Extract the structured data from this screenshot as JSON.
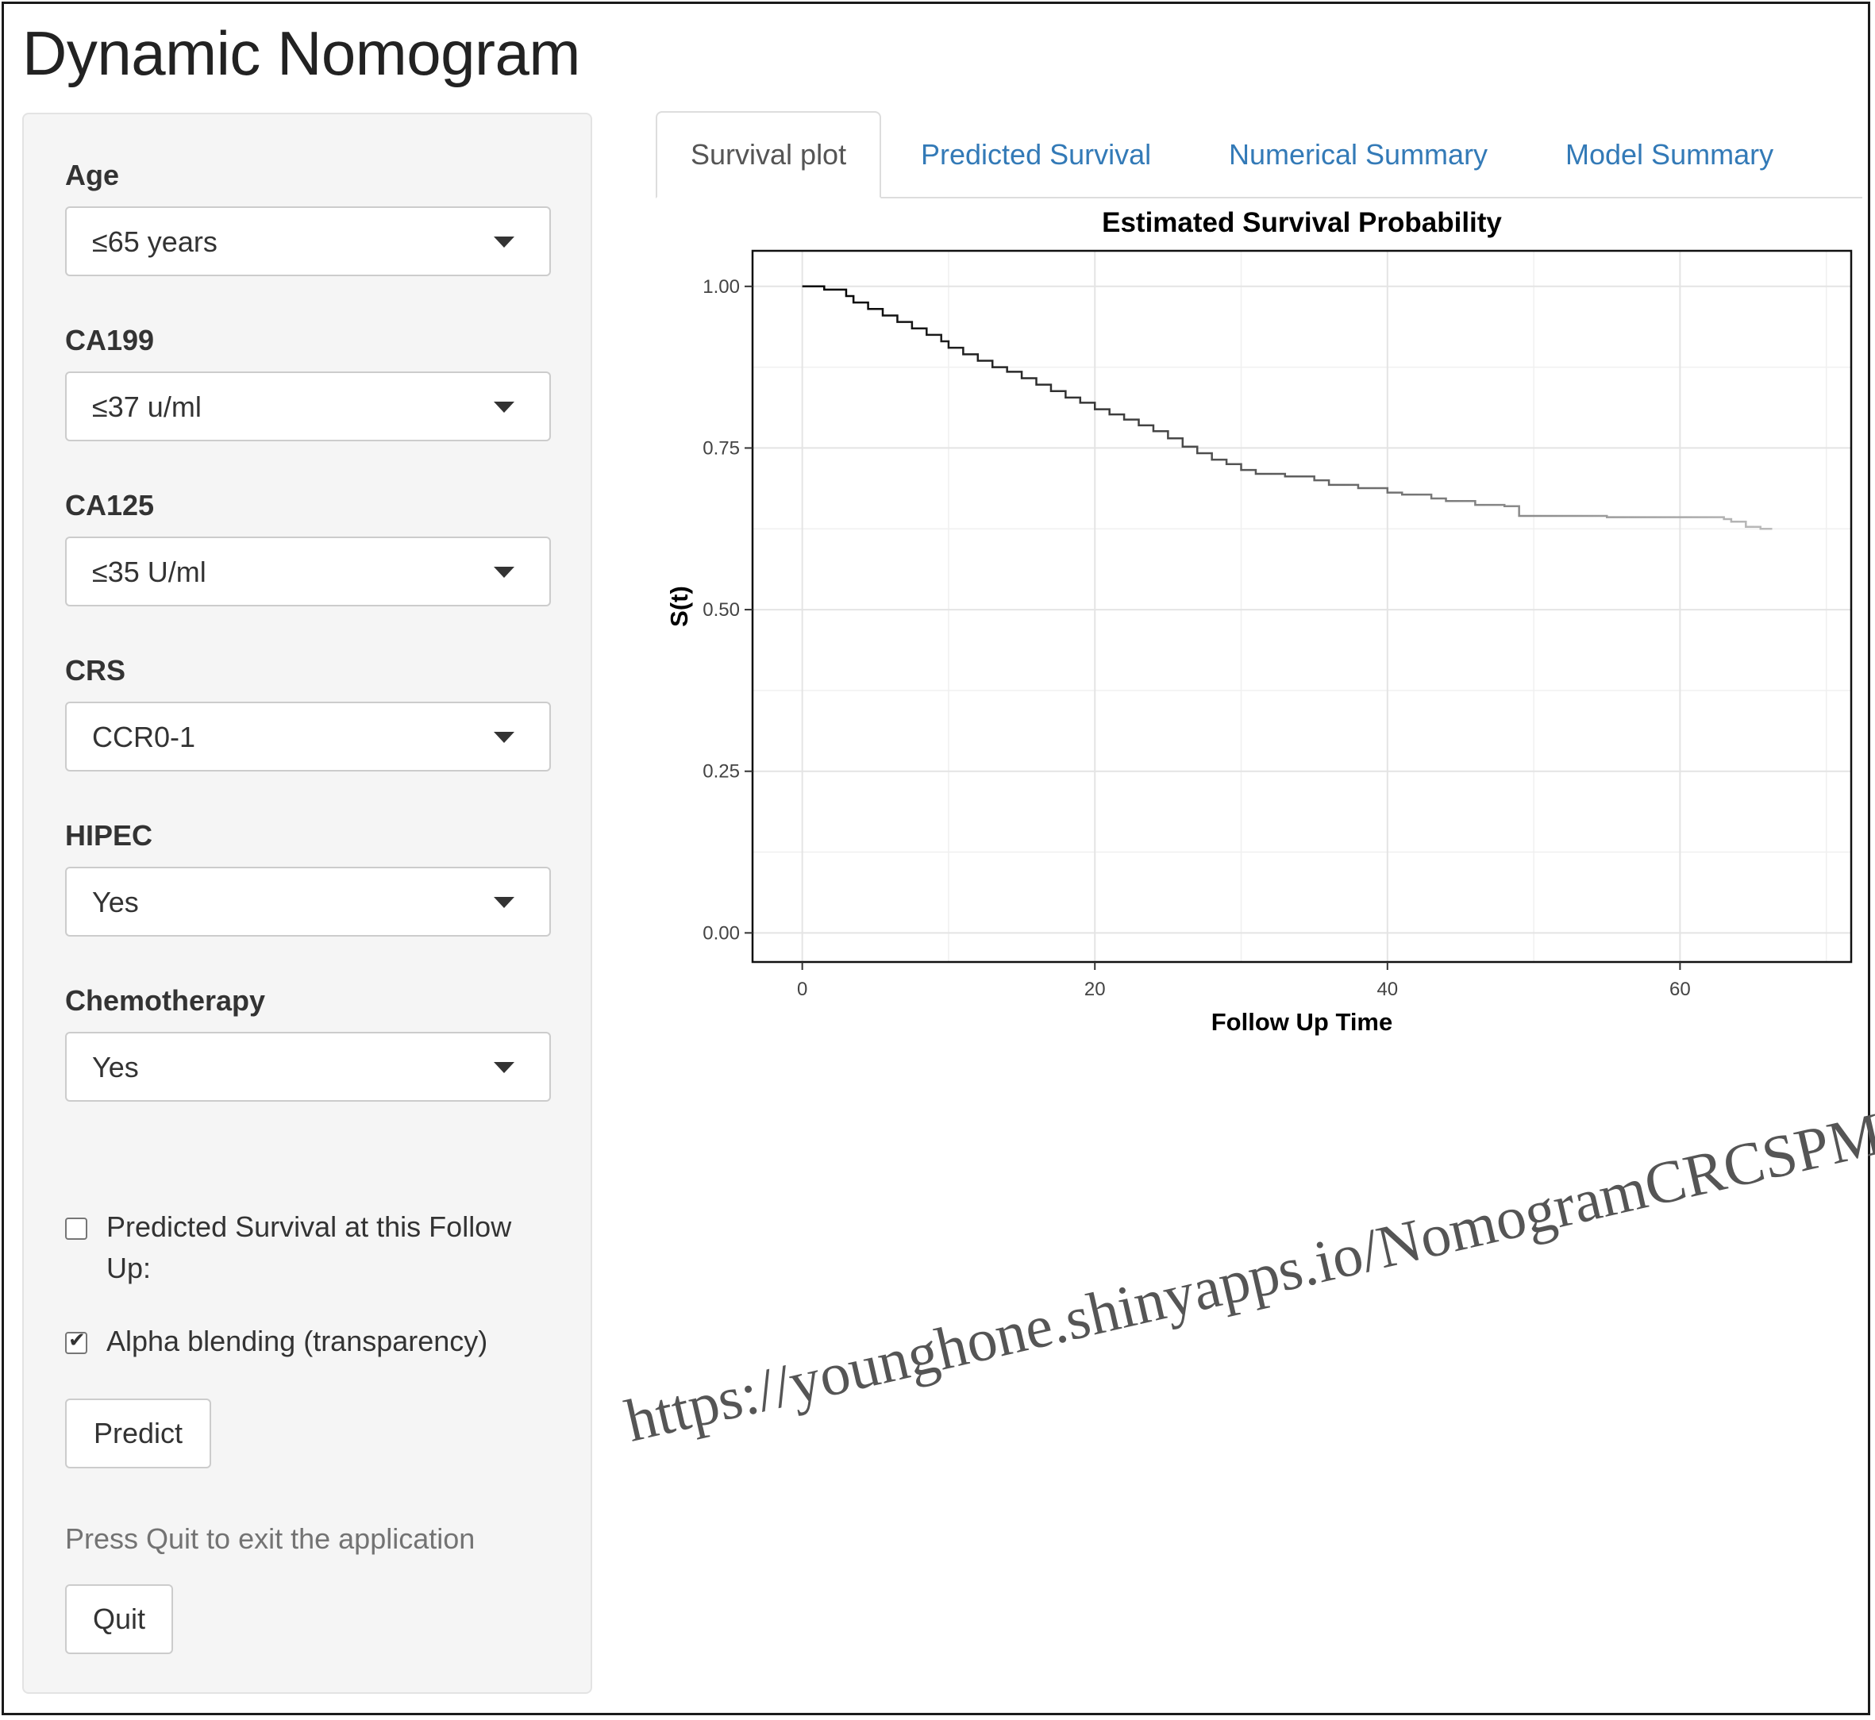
{
  "app": {
    "title": "Dynamic Nomogram"
  },
  "sidebar": {
    "fields": [
      {
        "label": "Age",
        "value": "≤65 years"
      },
      {
        "label": "CA199",
        "value": "≤37 u/ml"
      },
      {
        "label": "CA125",
        "value": "≤35 U/ml"
      },
      {
        "label": "CRS",
        "value": "CCR0-1"
      },
      {
        "label": "HIPEC",
        "value": "Yes"
      },
      {
        "label": "Chemotherapy",
        "value": "Yes"
      }
    ],
    "checkboxes": [
      {
        "label_line1": "Predicted Survival at this Follow",
        "label_line2": "Up:",
        "checked": false
      },
      {
        "label_line1": "Alpha blending (transparency)",
        "checked": true
      }
    ],
    "predict_label": "Predict",
    "quit_hint": "Press Quit to exit the application",
    "quit_label": "Quit"
  },
  "tabs": [
    {
      "label": "Survival plot",
      "active": true
    },
    {
      "label": "Predicted Survival",
      "active": false
    },
    {
      "label": "Numerical Summary",
      "active": false
    },
    {
      "label": "Model Summary",
      "active": false
    }
  ],
  "chart_data": {
    "type": "line",
    "title": "Estimated Survival Probability",
    "xlabel": "Follow Up Time",
    "ylabel": "S(t)",
    "xlim": [
      -3.4,
      71.7
    ],
    "ylim": [
      -0.045,
      1.055
    ],
    "x_ticks": [
      0,
      20,
      40,
      60
    ],
    "y_ticks": [
      0.0,
      0.25,
      0.5,
      0.75,
      1.0
    ],
    "y_tick_labels": [
      "0.00",
      "0.25",
      "0.50",
      "0.75",
      "1.00"
    ],
    "grid": true,
    "line_color_start": "#000000",
    "line_color_end": "#bbbbbb",
    "steps": [
      [
        0,
        1.0
      ],
      [
        1.5,
        0.995
      ],
      [
        3,
        0.985
      ],
      [
        3.5,
        0.975
      ],
      [
        4.5,
        0.965
      ],
      [
        5.5,
        0.955
      ],
      [
        6.5,
        0.945
      ],
      [
        7.5,
        0.935
      ],
      [
        8.5,
        0.925
      ],
      [
        9.5,
        0.915
      ],
      [
        10,
        0.905
      ],
      [
        11,
        0.895
      ],
      [
        12,
        0.885
      ],
      [
        13,
        0.875
      ],
      [
        14,
        0.868
      ],
      [
        15,
        0.858
      ],
      [
        16,
        0.848
      ],
      [
        17,
        0.838
      ],
      [
        18,
        0.828
      ],
      [
        19,
        0.82
      ],
      [
        20,
        0.81
      ],
      [
        21,
        0.802
      ],
      [
        22,
        0.794
      ],
      [
        23,
        0.785
      ],
      [
        24,
        0.776
      ],
      [
        25,
        0.765
      ],
      [
        26,
        0.752
      ],
      [
        27,
        0.742
      ],
      [
        28,
        0.732
      ],
      [
        29,
        0.725
      ],
      [
        30,
        0.716
      ],
      [
        31,
        0.71
      ],
      [
        33,
        0.706
      ],
      [
        35,
        0.7
      ],
      [
        36,
        0.693
      ],
      [
        38,
        0.688
      ],
      [
        40,
        0.681
      ],
      [
        41,
        0.678
      ],
      [
        43,
        0.672
      ],
      [
        44,
        0.668
      ],
      [
        46,
        0.662
      ],
      [
        48,
        0.66
      ],
      [
        49,
        0.645
      ],
      [
        55,
        0.643
      ],
      [
        63,
        0.64
      ],
      [
        63.5,
        0.636
      ],
      [
        64.5,
        0.628
      ],
      [
        65.5,
        0.625
      ]
    ]
  },
  "watermark": {
    "text": "https://younghone.shinyapps.io/NomogramCRCSPM/"
  }
}
